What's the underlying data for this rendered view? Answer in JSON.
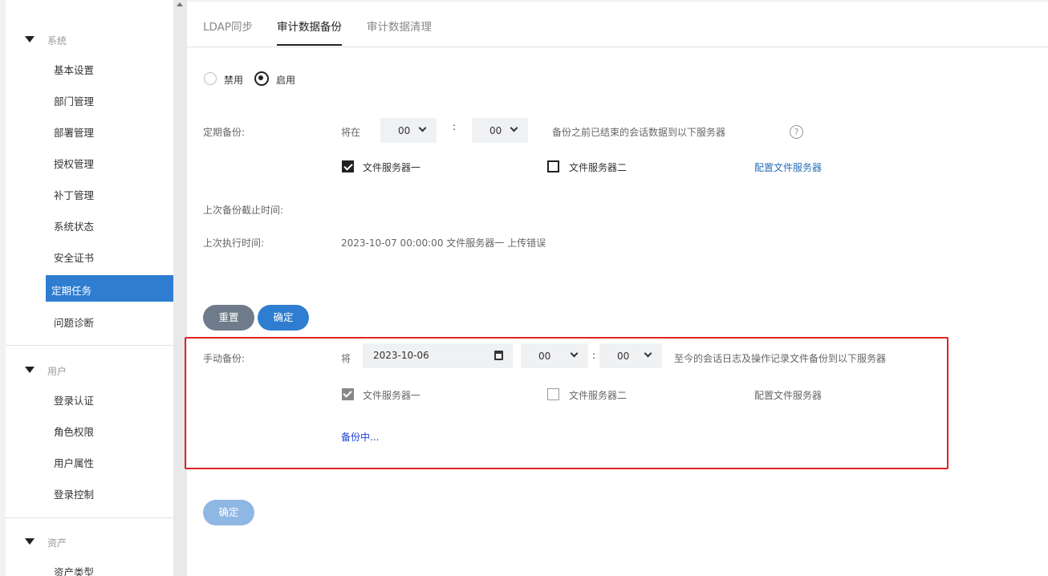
{
  "sidebar": {
    "groups": [
      {
        "label": "系统"
      },
      {
        "label": "用户"
      },
      {
        "label": "资产"
      }
    ],
    "system_items": [
      "基本设置",
      "部门管理",
      "部署管理",
      "授权管理",
      "补丁管理",
      "系统状态",
      "安全证书",
      "定期任务",
      "问题诊断"
    ],
    "user_items": [
      "登录认证",
      "角色权限",
      "用户属性",
      "登录控制"
    ],
    "asset_items": [
      "资产类型"
    ],
    "active_item": "定期任务"
  },
  "tabs": [
    "LDAP同步",
    "审计数据备份",
    "审计数据清理"
  ],
  "active_tab": "审计数据备份",
  "mode": {
    "disable_label": "禁用",
    "enable_label": "启用",
    "selected": "启用"
  },
  "scheduled": {
    "label": "定期备份:",
    "at_label": "将在",
    "hour": "00",
    "colon": ":",
    "minute": "00",
    "desc": "备份之前已结束的会话数据到以下服务器",
    "help_icon": "?",
    "server1": "文件服务器一",
    "server1_checked": true,
    "server2": "文件服务器二",
    "server2_checked": false,
    "config_link": "配置文件服务器",
    "last_cutoff_label": "上次备份截止时间:",
    "last_cutoff_value": "",
    "last_exec_label": "上次执行时间:",
    "last_exec_value": "2023-10-07 00:00:00 文件服务器一 上传错误",
    "reset_button": "重置",
    "confirm_button": "确定"
  },
  "manual": {
    "label": "手动备份:",
    "at_label": "将",
    "date": "2023-10-06",
    "hour": "00",
    "colon": ":",
    "minute": "00",
    "desc": "至今的会话日志及操作记录文件备份到以下服务器",
    "server1": "文件服务器一",
    "server1_checked": true,
    "server2": "文件服务器二",
    "server2_checked": false,
    "config_link": "配置文件服务器",
    "status": "备份中...",
    "confirm_button": "确定"
  },
  "colors": {
    "accent": "#2e7dd1",
    "highlight_box": "#e02424",
    "status_text": "#1a3fd6"
  }
}
